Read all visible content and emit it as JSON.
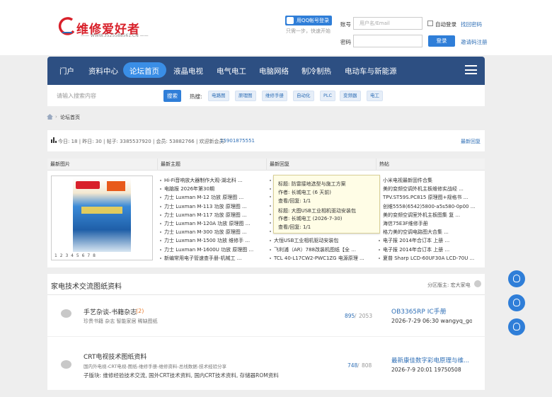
{
  "header": {
    "logo_text": "维修爱好者",
    "logo_sub": "—— WWW.3525588561.CN ——",
    "qq_login": "用QQ帐号登录",
    "qq_sub": "只需一步，快速开始",
    "account_label": "账号",
    "account_placeholder": "用户名/Email",
    "auto_login": "自动登录",
    "find_password": "找回密码",
    "password_label": "密码",
    "login_button": "登录",
    "register": "邀请码注册"
  },
  "nav": {
    "items": [
      "门户",
      "资料中心",
      "论坛首页",
      "液晶电视",
      "电气电工",
      "电脑网络",
      "制冷制热",
      "电动车与新能源"
    ]
  },
  "search": {
    "placeholder": "请输入搜索内容",
    "button": "搜索",
    "hot_label": "热搜:",
    "tags": [
      "电路图",
      "原理图",
      "维修手册",
      "自动化",
      "PLC",
      "变频器",
      "电工"
    ]
  },
  "breadcrumb": {
    "home_icon": "home-icon",
    "label": "论坛首页"
  },
  "stats": {
    "icon": "bar-chart-icon",
    "text_prefix": "今日: 18 | 昨日: 30 | 帖子: 3385537920 | 会员: 53882766 | 欢迎新会员:",
    "new_member": "15901875551",
    "latest_reply": "最新回复"
  },
  "panel": {
    "headers": [
      "最新图片",
      "最新主题",
      "最新回复",
      "热帖"
    ],
    "magazine_pages": "1 2 3 4 5 6 7 8",
    "latest_topics": [
      "Hi-Fi音响放大器制作大观-湖北科 ...",
      "电脑报 2026年第30期",
      "力士 Luxman M-12 功放 原理图 ...",
      "力士 Luxman M-113 功放 原理图 ...",
      "力士 Luxman M-117 功放 原理图 ...",
      "力士 Luxman M-120A 功放 原理图 ...",
      "力士 Luxman M-300 功放 原理图 ...",
      "力士 Luxman M-1500 功放 维修手 ...",
      "力士 Luxman M-1600U 功放 原理图 ...",
      "新编常用电子管速查手册-机械工 ..."
    ],
    "latest_replies": [
      "防雷接地选型与施工方案",
      "大图USB工业相机驱动安装包",
      "...",
      "...",
      "...",
      "...",
      "...",
      "大恒USB工业相机驱动安装包",
      "飞利浦（AR）788改装机图纸【全 ...",
      "TCL 40-L17CW2-PWC1ZG 电源原理 ..."
    ],
    "hot_posts": [
      "小米电视最新固件合集",
      "美的变频空调外机主板维修实战经 ...",
      "TPV.ST59S.PC815 原理图+规格书 ...",
      "创维5558(6542)5800-a5s580-0p00 ...",
      "美的变频空调室外机主板图集 复 ...",
      "海信75E3F维修手册",
      "格力美的空调电路图大合集 ...",
      "电子报 2014年合订本 上册 ...",
      "电子报 2014年合订本 上册 ...",
      "夏普 Sharp LCD-60UF30A LCD-70U ..."
    ],
    "tooltip": {
      "title1": "标题: 防雷接地选型与施工方案",
      "author1": "作者: 长城电工 (6 天前)",
      "views1": "查看/回复: 1/1",
      "title2": "标题: 大图USB工业相机驱动安装包",
      "author2": "作者: 长城电工 (2026-7-30)",
      "views2": "查看/回复: 1/1"
    }
  },
  "section": {
    "title": "家电技术交流图纸资料",
    "moderator": "分区版主: 宏大家电",
    "forums": [
      {
        "name": "手艺杂谈-书籍杂志",
        "new": "(2)",
        "desc": "珍贵书籍 杂志 智能家居 稀缺图纸",
        "threads": "895",
        "posts": "2053",
        "last_title": "OB3365RP IC手册",
        "last_time": "2026-7-29 06:30 wangyq_gooc"
      },
      {
        "name": "CRT电视技术图纸资料",
        "new": "",
        "desc": "国内外电视-CRT电视-图纸-维修手册-维修资料-总线数据-技术经验分享",
        "sub": "子版块: 维修经验技术交流, 国外CRT技术资料, 国内CRT技术资料, 存储器ROM资料",
        "threads": "748",
        "posts": "808",
        "last_title": "最新康佳数字彩电原理与维...",
        "last_time": "2026-7-9 20:01 19750508"
      }
    ]
  },
  "float_icons": [
    "qq-icon",
    "wechat-icon",
    "qq-icon"
  ],
  "colors": {
    "nav_bg": "#2d4f82",
    "accent": "#2f7ed8",
    "logo_red": "#d8202a"
  }
}
